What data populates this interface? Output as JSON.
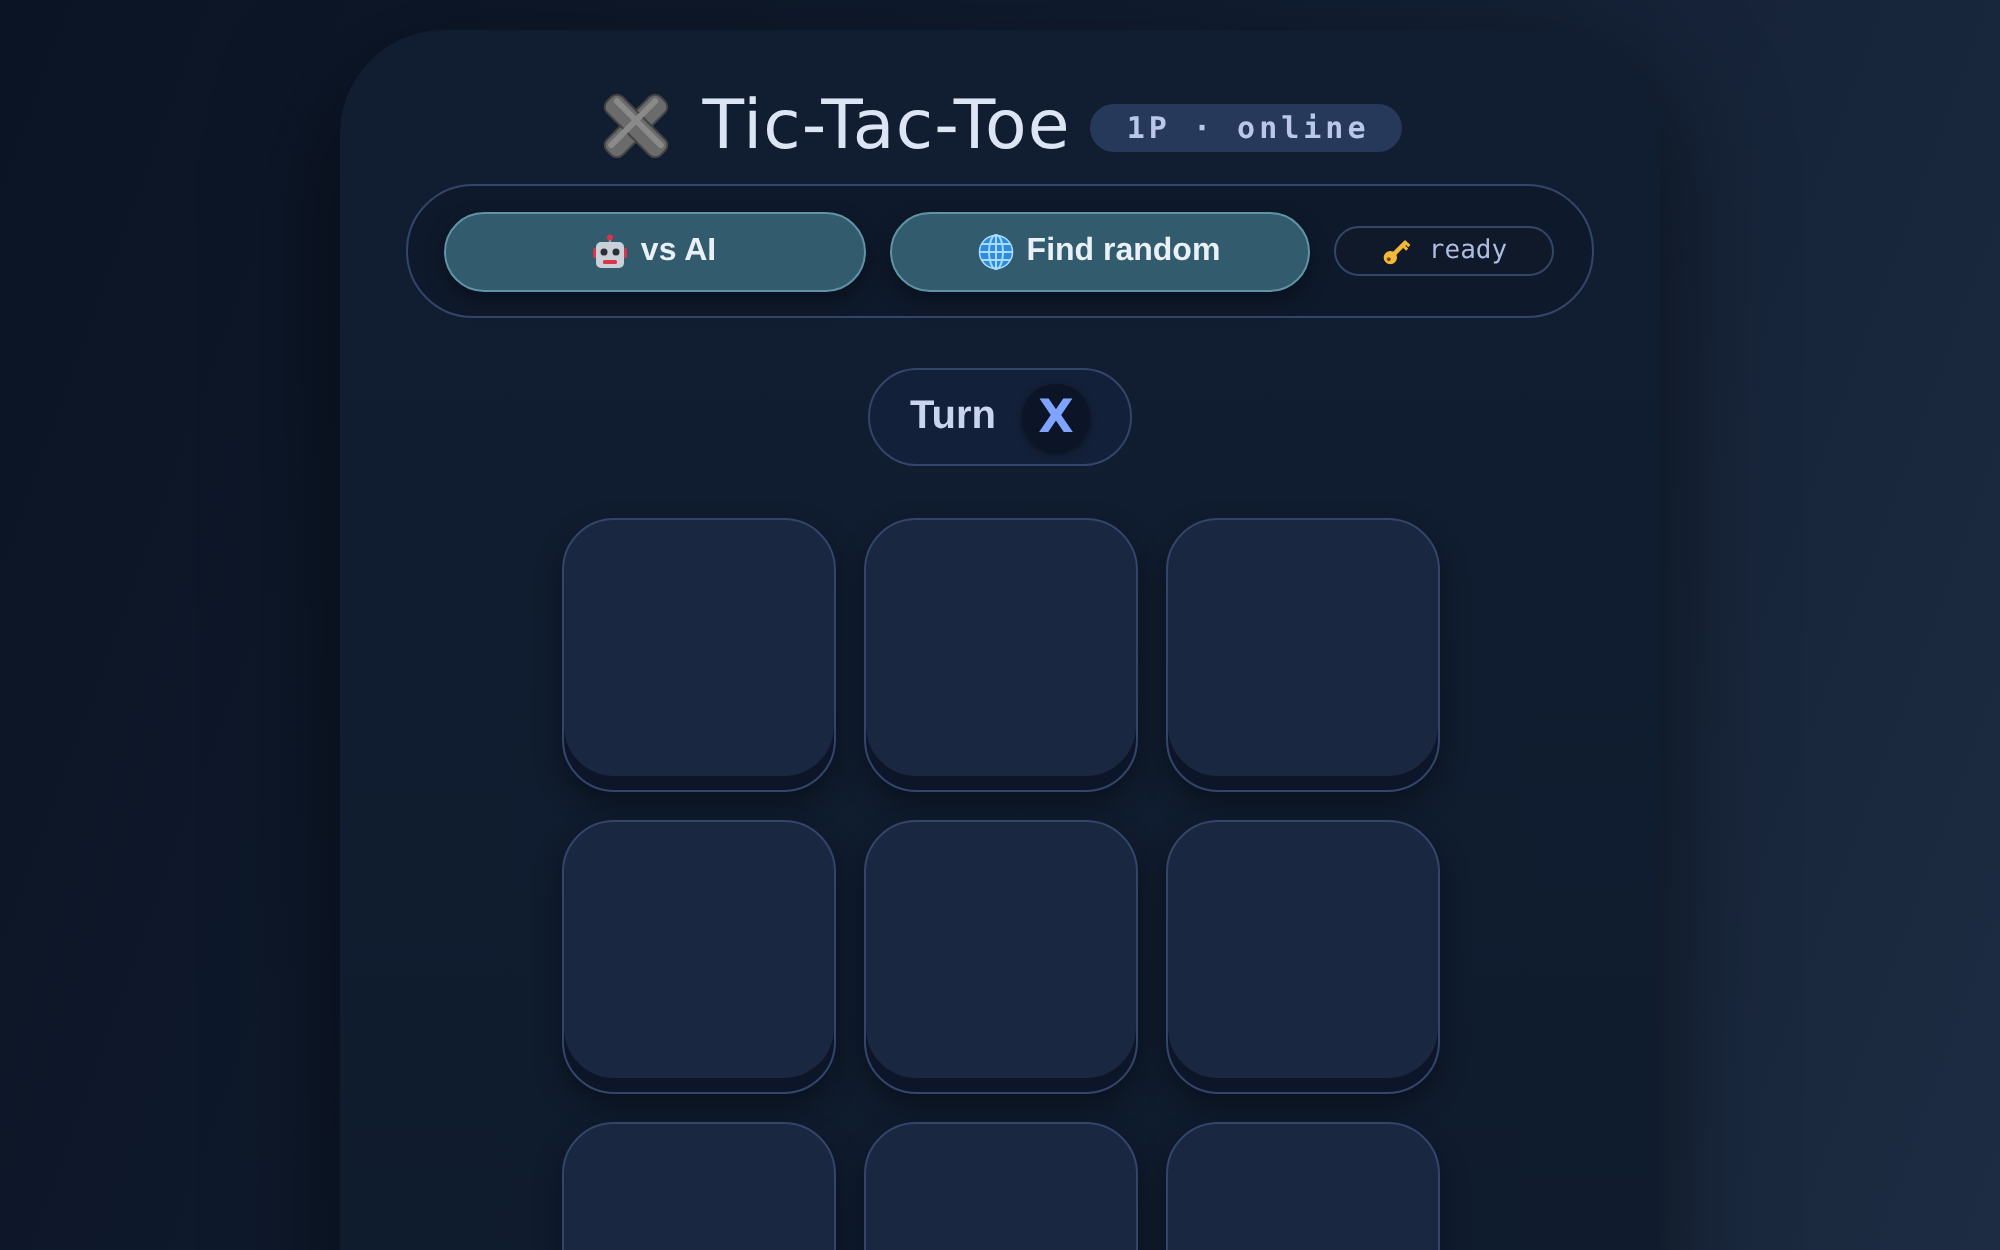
{
  "header": {
    "title": "Tic-Tac-Toe",
    "badge": "1P · online"
  },
  "controls": {
    "buttons": [
      {
        "label": "vs AI",
        "kind": "ai"
      },
      {
        "label": "Find random",
        "kind": "random"
      }
    ],
    "status": "ready"
  },
  "turn": {
    "label": "Turn",
    "player": "X"
  },
  "board": {
    "cells": [
      {
        "kind": "empty"
      },
      {
        "kind": "empty"
      },
      {
        "kind": "empty"
      },
      {
        "kind": "empty"
      },
      {
        "kind": "empty"
      },
      {
        "kind": "empty"
      },
      {
        "kind": "empty"
      },
      {
        "kind": "empty"
      },
      {
        "kind": "empty"
      }
    ]
  }
}
